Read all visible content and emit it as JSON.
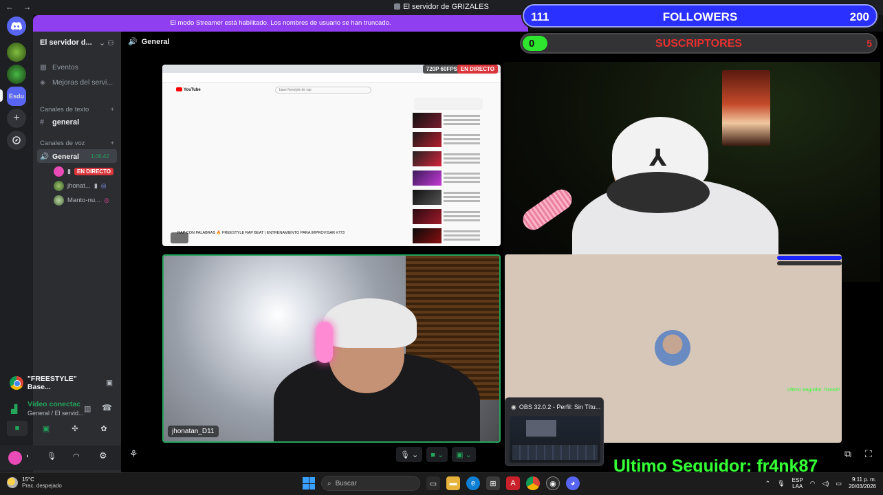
{
  "window": {
    "title": "El servidor de GRIZALES",
    "nav_back": "←",
    "nav_forward": "→"
  },
  "banner": {
    "text": "El modo Streamer está habilitado. Los nombres de usuario se han truncado."
  },
  "rail": {
    "icons": [
      "discord-home-icon",
      "server-avatar-1",
      "server-avatar-2",
      "server-avatar-active",
      "add-server-icon",
      "discover-icon"
    ],
    "active_label": "Esdu"
  },
  "sidebar": {
    "server_name": "El servidor d...",
    "items": [
      {
        "label": "Eventos",
        "icon": "calendar-icon"
      },
      {
        "label": "Mejoras del servi...",
        "icon": "boost-icon"
      }
    ],
    "text_category": "Canales de texto",
    "text_channel": "general",
    "voice_category": "Canales de voz",
    "voice_channel": "General",
    "voice_timer": "1:06:42",
    "voice_users": [
      {
        "name": "",
        "badge": "EN DIRECTO"
      },
      {
        "name": "jhonat..."
      },
      {
        "name": "Manto-nu..."
      }
    ]
  },
  "activity": {
    "label": "\"FREESTYLE\" Base..."
  },
  "voice_connection": {
    "status": "Vídeo conectac",
    "location": "General / El servid..."
  },
  "main": {
    "channel_name": "General",
    "stream": {
      "resolution": "720P 60FPS",
      "live": "EN DIRECTO",
      "search_placeholder": "base freestyle de rap",
      "video_title": "RAP CON PALABRAS 🔥 FREESTYLE RAP BEAT | ENTRENAMIENTO PARA IMPROVISAR #773",
      "site": "YouTube"
    },
    "tiles": [
      {
        "name": "jhonatan_D11"
      }
    ],
    "obs_preview": {
      "title": "OBS 32.0.2 - Perfil: Sin Títu..."
    }
  },
  "overlay": {
    "followers_current": "111",
    "followers_label": "FOLLOWERS",
    "followers_goal": "200",
    "followers_progress": 0.555,
    "subs_current": "0",
    "subs_label": "SUSCRIPTORES",
    "subs_goal": "5",
    "last_follower": "Ultimo Seguidor: fr4nk87",
    "mini_tag": "Ultimo Seguidor: fr4nk87"
  },
  "taskbar": {
    "weather_temp": "15°C",
    "weather_desc": "Prac. despejado",
    "search_label": "Buscar",
    "lang_1": "ESP",
    "lang_2": "LAA",
    "time": "9:11 p. m.",
    "date": "20/03/2026"
  },
  "colors": {
    "blurple": "#5865f2",
    "live_red": "#da373c",
    "speaking_green": "#23a55a",
    "overlay_blue": "#2a30ff",
    "overlay_green": "#35ff35",
    "streamer_purple": "#8f3ff0"
  }
}
